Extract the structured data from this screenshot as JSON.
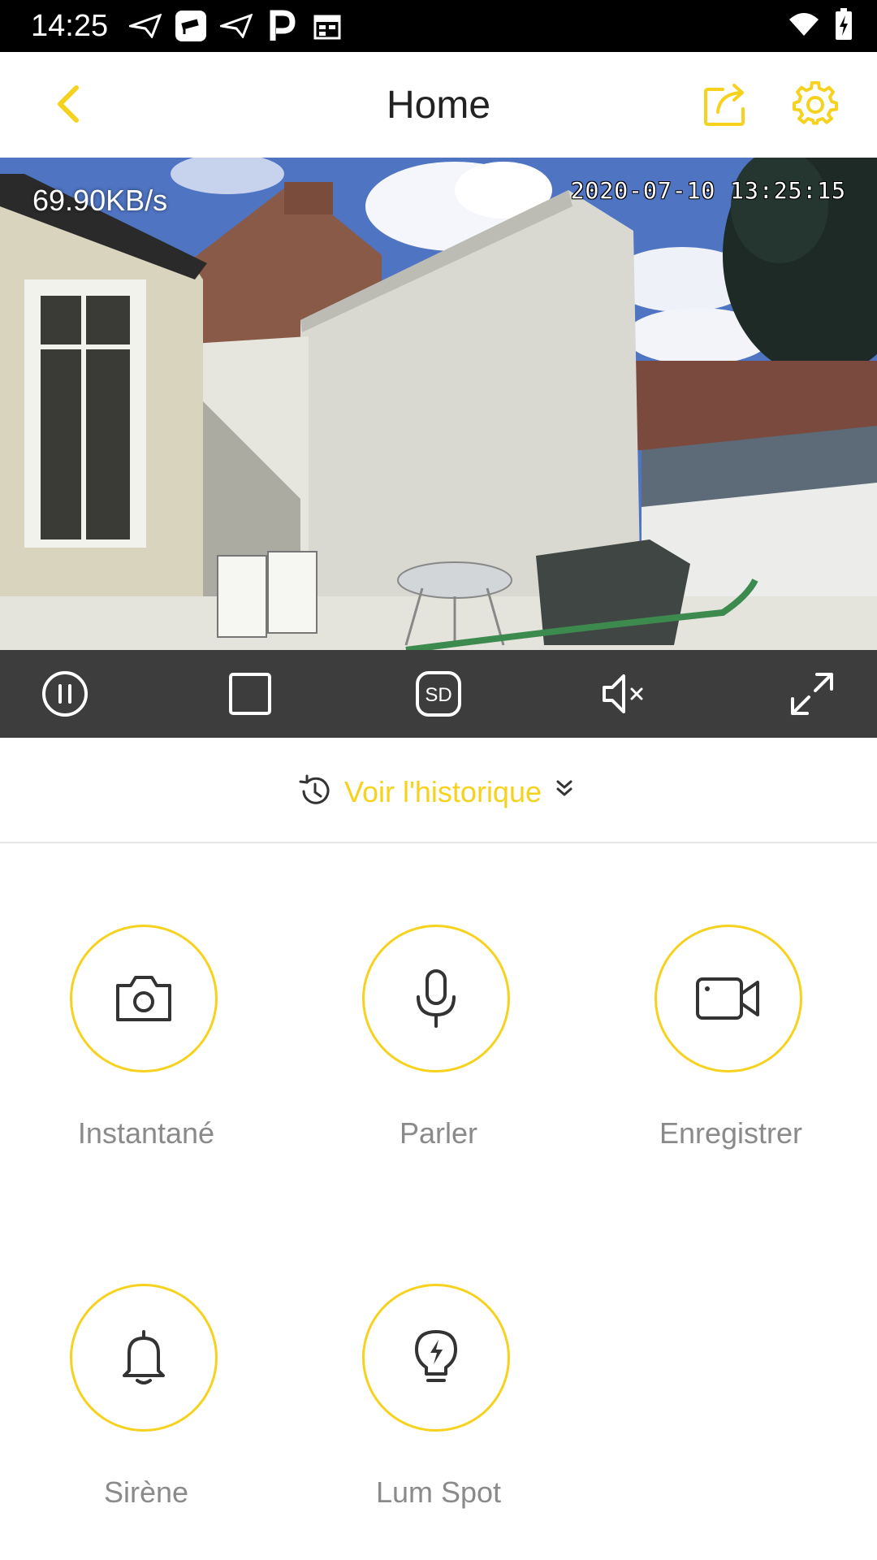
{
  "status_bar": {
    "time": "14:25"
  },
  "app_bar": {
    "title": "Home"
  },
  "camera": {
    "bitrate": "69.90KB/s",
    "timestamp": "2020-07-10 13:25:15"
  },
  "controls": [
    {
      "icon": "pause-icon"
    },
    {
      "icon": "record-stop-icon"
    },
    {
      "icon": "sd-icon",
      "label": "SD"
    },
    {
      "icon": "mute-icon"
    },
    {
      "icon": "fullscreen-icon"
    }
  ],
  "history": {
    "label": "Voir l'historique"
  },
  "actions": [
    {
      "icon": "camera-icon",
      "label": "Instantané"
    },
    {
      "icon": "microphone-icon",
      "label": "Parler"
    },
    {
      "icon": "video-camera-icon",
      "label": "Enregistrer"
    },
    {
      "icon": "bell-icon",
      "label": "Sirène"
    },
    {
      "icon": "bulb-icon",
      "label": "Lum Spot"
    }
  ],
  "colors": {
    "accent": "#f6d21e",
    "control_bar": "#3d3d3d"
  }
}
